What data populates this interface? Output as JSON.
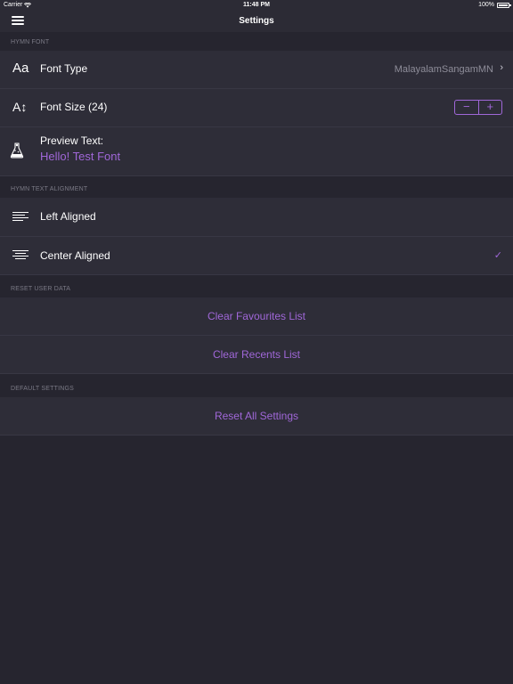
{
  "status_bar": {
    "carrier": "Carrier",
    "time": "11:48 PM",
    "battery": "100%"
  },
  "nav": {
    "title": "Settings"
  },
  "sections": {
    "hymn_font": {
      "header": "HYMN FONT",
      "font_type": {
        "label": "Font Type",
        "value": "MalayalamSangamMN"
      },
      "font_size": {
        "label": "Font Size (24)",
        "minus": "−",
        "plus": "+"
      },
      "preview": {
        "label": "Preview Text:",
        "text": "Hello! Test Font"
      }
    },
    "alignment": {
      "header": "HYMN TEXT ALIGNMENT",
      "left": "Left Aligned",
      "center": "Center Aligned",
      "selected": "center"
    },
    "reset_user_data": {
      "header": "RESET USER DATA",
      "clear_favourites": "Clear Favourites List",
      "clear_recents": "Clear Recents List"
    },
    "default_settings": {
      "header": "DEFAULT SETTINGS",
      "reset_all": "Reset All Settings"
    }
  },
  "icons": {
    "font_type": "Aa",
    "font_size": "A↕",
    "preview": "flask-icon",
    "checkmark": "✓",
    "chevron": "›"
  },
  "colors": {
    "background": "#26252f",
    "row": "#2e2d38",
    "accent": "#a067d8",
    "secondary_text": "#8e8d99"
  }
}
